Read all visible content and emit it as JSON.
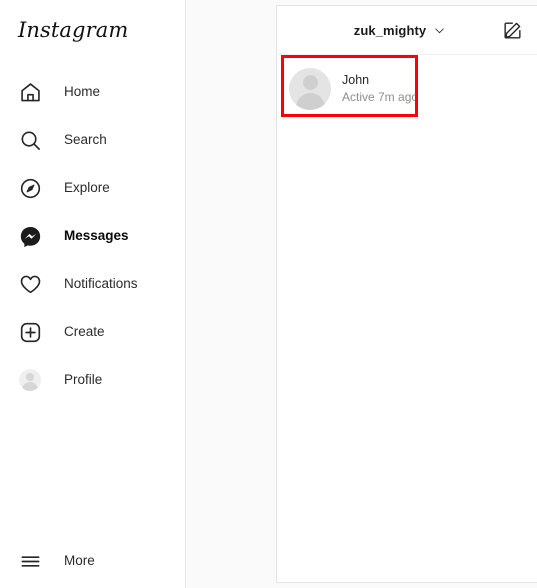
{
  "brand": {
    "logo_text": "Instagram"
  },
  "sidebar": {
    "items": [
      {
        "label": "Home",
        "icon": "home-icon",
        "active": false
      },
      {
        "label": "Search",
        "icon": "search-icon",
        "active": false
      },
      {
        "label": "Explore",
        "icon": "compass-icon",
        "active": false
      },
      {
        "label": "Messages",
        "icon": "messenger-icon",
        "active": true
      },
      {
        "label": "Notifications",
        "icon": "heart-icon",
        "active": false
      },
      {
        "label": "Create",
        "icon": "plus-square-icon",
        "active": false
      },
      {
        "label": "Profile",
        "icon": "avatar-icon",
        "active": false
      }
    ],
    "more": {
      "label": "More",
      "icon": "hamburger-menu-icon"
    }
  },
  "panel": {
    "header": {
      "account_name": "zuk_mighty",
      "chevron_icon": "chevron-down-icon",
      "compose_icon": "compose-new-message-icon"
    },
    "conversations": [
      {
        "name": "John",
        "status": "Active 7m ago",
        "avatar_icon": "avatar-placeholder-icon"
      }
    ]
  },
  "annotation": {
    "highlight_color": "#fb0007"
  },
  "colors": {
    "background": "#fafafa",
    "panel_background": "#ffffff",
    "text_primary": "#262626",
    "text_secondary": "#8e8e8e",
    "border": "#e4e4e4"
  }
}
